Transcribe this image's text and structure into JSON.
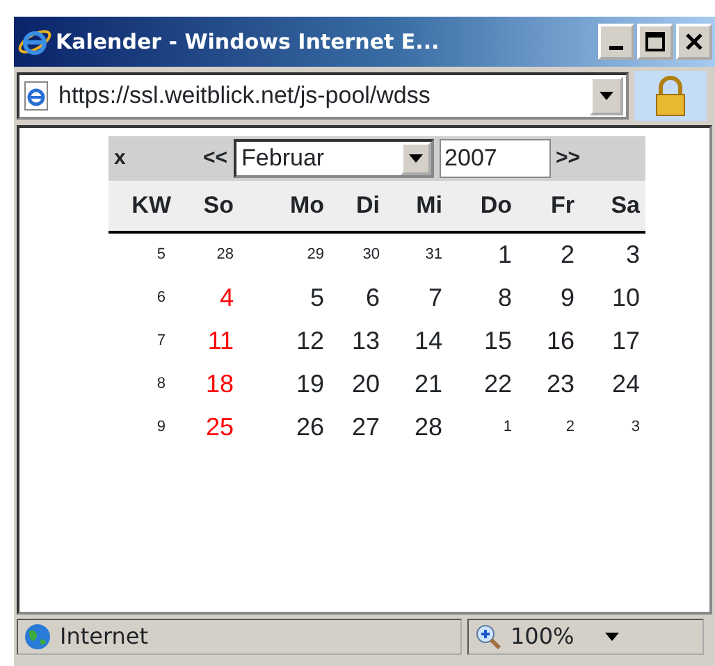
{
  "window": {
    "title": "Kalender - Windows Internet E..."
  },
  "address_bar": {
    "url": "https://ssl.weitblick.net/js-pool/wdss"
  },
  "calendar": {
    "close": "x",
    "prev": "<<",
    "month": "Februar",
    "year": "2007",
    "next": ">>",
    "headers": [
      "KW",
      "So",
      "Mo",
      "Di",
      "Mi",
      "Do",
      "Fr",
      "Sa"
    ],
    "weeks": [
      {
        "kw": "5",
        "days": [
          {
            "text": "28",
            "kind": "other"
          },
          {
            "text": "29",
            "kind": "other"
          },
          {
            "text": "30",
            "kind": "other"
          },
          {
            "text": "31",
            "kind": "other"
          },
          {
            "text": "1",
            "kind": "day"
          },
          {
            "text": "2",
            "kind": "day"
          },
          {
            "text": "3",
            "kind": "day"
          }
        ]
      },
      {
        "kw": "6",
        "days": [
          {
            "text": "4",
            "kind": "sunday"
          },
          {
            "text": "5",
            "kind": "day"
          },
          {
            "text": "6",
            "kind": "day"
          },
          {
            "text": "7",
            "kind": "day"
          },
          {
            "text": "8",
            "kind": "day"
          },
          {
            "text": "9",
            "kind": "day"
          },
          {
            "text": "10",
            "kind": "day"
          }
        ]
      },
      {
        "kw": "7",
        "days": [
          {
            "text": "11",
            "kind": "sunday"
          },
          {
            "text": "12",
            "kind": "day"
          },
          {
            "text": "13",
            "kind": "day"
          },
          {
            "text": "14",
            "kind": "day"
          },
          {
            "text": "15",
            "kind": "day"
          },
          {
            "text": "16",
            "kind": "day"
          },
          {
            "text": "17",
            "kind": "day"
          }
        ]
      },
      {
        "kw": "8",
        "days": [
          {
            "text": "18",
            "kind": "sunday"
          },
          {
            "text": "19",
            "kind": "day"
          },
          {
            "text": "20",
            "kind": "day"
          },
          {
            "text": "21",
            "kind": "day"
          },
          {
            "text": "22",
            "kind": "day"
          },
          {
            "text": "23",
            "kind": "day"
          },
          {
            "text": "24",
            "kind": "day"
          }
        ]
      },
      {
        "kw": "9",
        "days": [
          {
            "text": "25",
            "kind": "sunday"
          },
          {
            "text": "26",
            "kind": "day"
          },
          {
            "text": "27",
            "kind": "day"
          },
          {
            "text": "28",
            "kind": "day"
          },
          {
            "text": "1",
            "kind": "other"
          },
          {
            "text": "2",
            "kind": "other"
          },
          {
            "text": "3",
            "kind": "other"
          }
        ]
      }
    ]
  },
  "status_bar": {
    "zone": "Internet",
    "zoom": "100%"
  }
}
